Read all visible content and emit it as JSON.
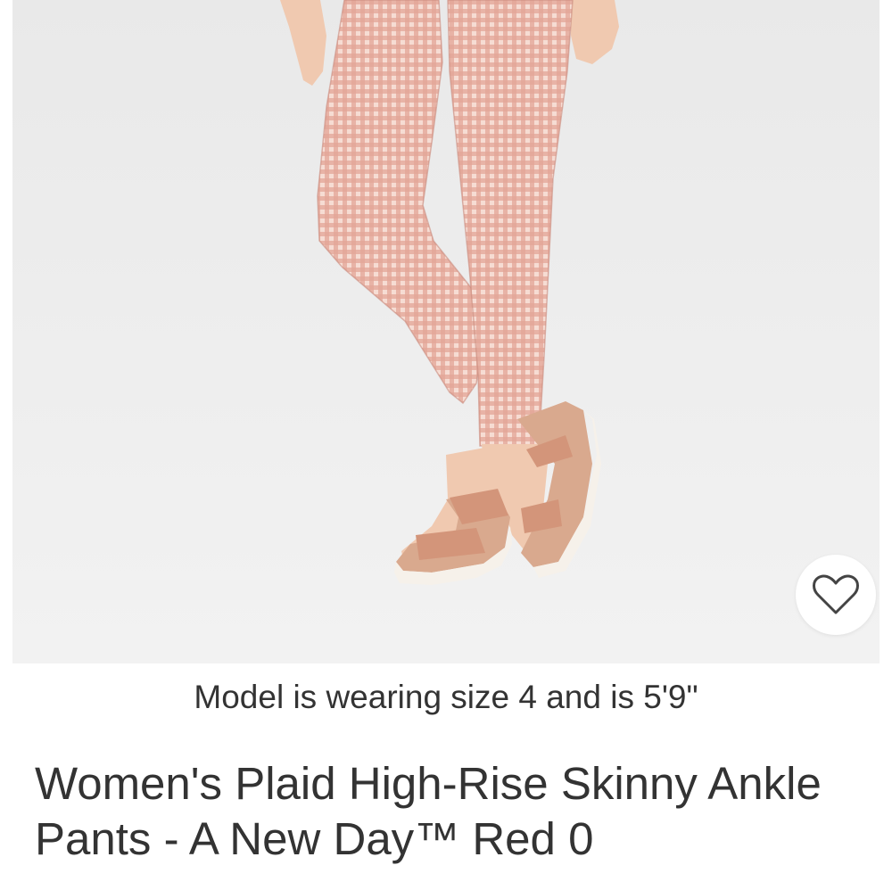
{
  "product_image": {
    "description_icon": "product-photo-pants",
    "favorite_icon": "heart-outline-icon",
    "colors": {
      "background": "#ececec",
      "fabric_light": "#f2cfc4",
      "fabric_check": "#d48a7c",
      "skin": "#f0c9b0",
      "sandal": "#d9a98e",
      "sole": "#f6f1ea"
    }
  },
  "caption": "Model is wearing size 4 and is 5'9\"",
  "product": {
    "title": "Women's Plaid High-Rise Skinny Ankle Pants - A New Day™ Red 0"
  }
}
